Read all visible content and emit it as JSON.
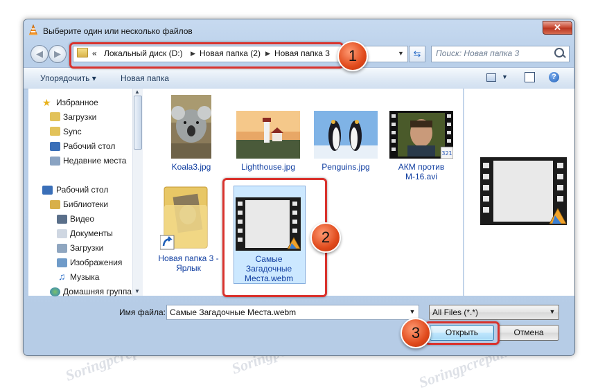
{
  "window": {
    "title": "Выберите один или несколько файлов",
    "close_symbol": "✕"
  },
  "address": {
    "crumbs": [
      "Локальный диск (D:)",
      "Новая папка (2)",
      "Новая папка 3"
    ],
    "lead_symbol": "«",
    "sep_symbol": "▶"
  },
  "search": {
    "placeholder": "Поиск: Новая папка 3"
  },
  "toolbar": {
    "organize": "Упорядочить ▾",
    "new_folder": "Новая папка"
  },
  "navpane": {
    "favorites_header": "Избранное",
    "favorites": [
      "Загрузки",
      "Sync",
      "Рабочий стол",
      "Недавние места"
    ],
    "desktop": "Рабочий стол",
    "libraries": "Библиотеки",
    "library_items": [
      "Видео",
      "Документы",
      "Загрузки",
      "Изображения",
      "Музыка"
    ],
    "homegroup": "Домашняя группа"
  },
  "files": [
    {
      "name": "Koala3.jpg"
    },
    {
      "name": "Lighthouse.jpg"
    },
    {
      "name": "Penguins.jpg"
    },
    {
      "name": "АКМ против М-16.avi"
    },
    {
      "name": "Новая папка 3 - Ярлык"
    },
    {
      "name": "Самые Загадочные Места.webm",
      "selected": true
    }
  ],
  "bottom": {
    "filename_label": "Имя файла:",
    "filename_value": "Самые Загадочные Места.webm",
    "filter_value": "All Files (*.*)",
    "open_label": "Открыть",
    "cancel_label": "Отмена"
  },
  "badges": [
    "1",
    "2",
    "3"
  ],
  "watermark": "Soringpcrepair.com",
  "colors": {
    "annotation_red": "#d9322d",
    "badge_orange": "#e04a1c",
    "link_blue": "#0f3da0",
    "selection": "#cce8ff"
  }
}
